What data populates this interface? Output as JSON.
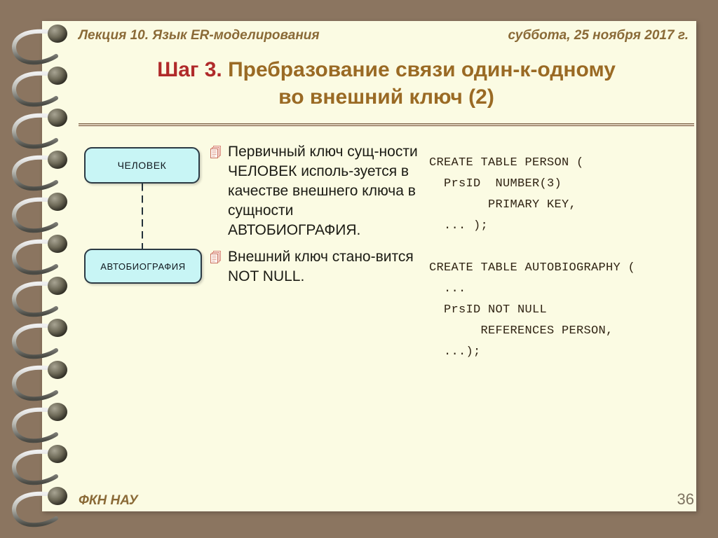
{
  "slide": {
    "header": {
      "lecture": "Лекция 10.  Язык ER-моделирования",
      "date": "суббота, 25 ноября 2017 г."
    },
    "title": {
      "step": "Шаг 3.",
      "rest": " Пребразование связи один-к-одному",
      "line2": "во внешний ключ (2)"
    },
    "diagram": {
      "entities": [
        {
          "name": "ЧЕЛОВЕК"
        },
        {
          "name": "АВТОБИОГРАФИЯ"
        }
      ],
      "link_style": "dashed"
    },
    "bullets": [
      {
        "icon": "documents-icon",
        "text": "Первичный ключ сущ-ности ЧЕЛОВЕК исполь-зуется в качестве внешнего ключа в сущности АВТОБИОГРАФИЯ."
      },
      {
        "icon": "documents-icon",
        "text": "Внешний ключ стано-вится NOT NULL."
      }
    ],
    "code_blocks": [
      {
        "name": "person-table",
        "text": "CREATE TABLE PERSON (\n  PrsID  NUMBER(3)\n        PRIMARY KEY,\n  ... );"
      },
      {
        "name": "autobiography-table",
        "text": "CREATE TABLE AUTOBIOGRAPHY (\n  ...\n  PrsID NOT NULL\n       REFERENCES PERSON,\n  ...);"
      }
    ],
    "footer": {
      "org": "ФКН НАУ",
      "page_number": "36"
    },
    "colors": {
      "background": "#8b7560",
      "paper": "#fbfbe3",
      "title_brown": "#9a6a24",
      "title_red": "#b02a2a",
      "header_brown": "#8a6a37",
      "entity_fill": "#c8f5f5",
      "entity_border": "#2c3a44",
      "code_text": "#302414",
      "bullet_icon": "#e8a89a"
    }
  }
}
